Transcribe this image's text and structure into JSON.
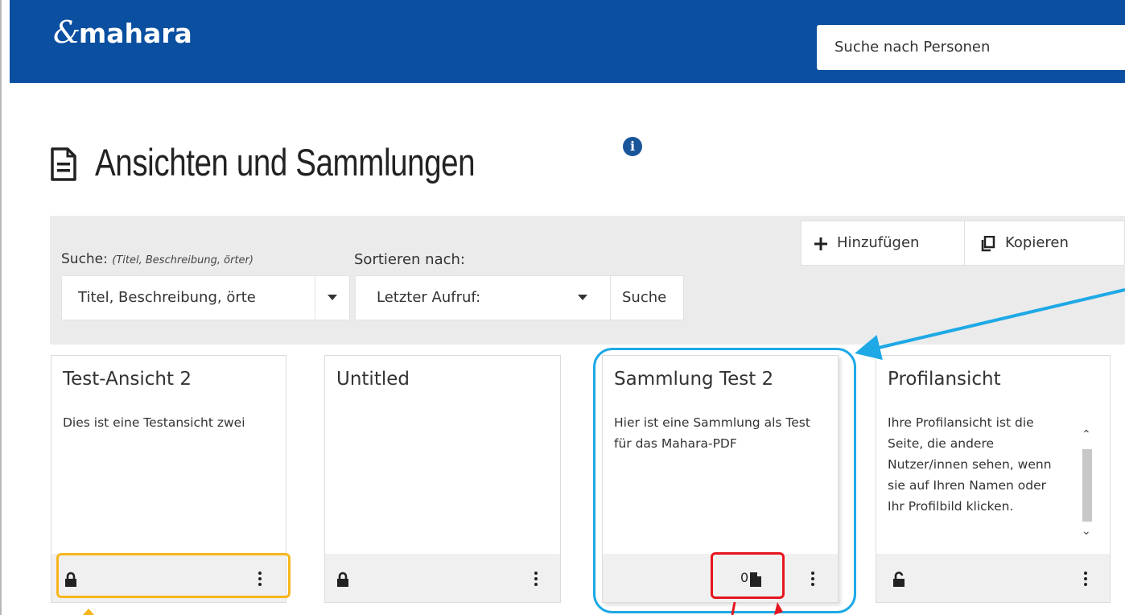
{
  "header": {
    "logo_text": "mahara",
    "logo_swirl": "&",
    "search_placeholder": "Suche nach Personen",
    "bg_color": "#0a4fa0"
  },
  "page": {
    "title": "Ansichten und Sammlungen"
  },
  "filters": {
    "search_label": "Suche:",
    "search_hint": "(Titel, Beschreibung, örter)",
    "search_value": "Titel, Beschreibung, örte",
    "sort_label": "Sortieren nach:",
    "sort_value": "Letzter Aufruf:",
    "search_button": "Suche",
    "add_button": "Hinzufügen",
    "copy_button": "Kopieren"
  },
  "cards": [
    {
      "title": "Test-Ansicht 2",
      "description": "Dies ist eine Testansicht zwei",
      "lock": "locked"
    },
    {
      "title": "Untitled",
      "description": "",
      "lock": "locked"
    },
    {
      "title": "Sammlung Test 2",
      "description": "Hier ist eine Sammlung als Test für das Mahara-PDF",
      "page_count": "0"
    },
    {
      "title": "Profilansicht",
      "description": "Ihre Profilansicht ist die Seite, die andere Nutzer/innen sehen, wenn sie auf Ihren Namen oder Ihr Profilbild klicken.",
      "lock": "unlocked"
    }
  ],
  "annotation_colors": {
    "orange": "#f7b51c",
    "blue": "#1ea9e6",
    "red": "#e6151f"
  }
}
